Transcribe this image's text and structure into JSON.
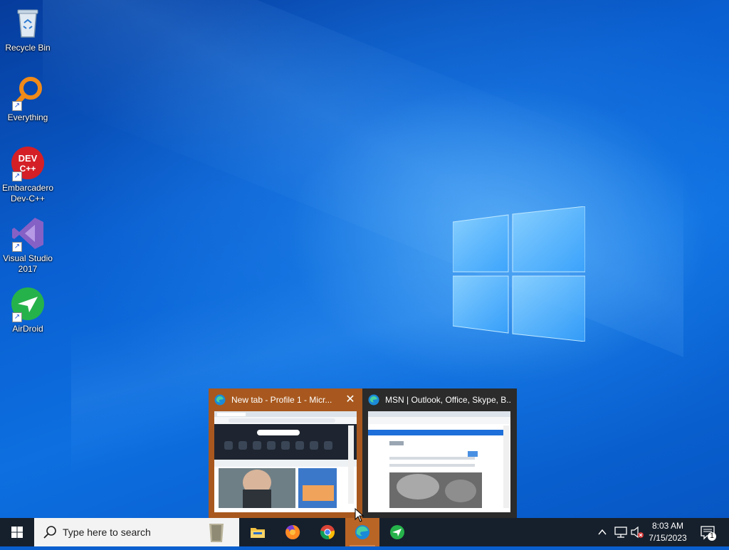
{
  "desktop": {
    "icons": [
      {
        "label": "Recycle Bin",
        "icon": "recycle-bin-icon"
      },
      {
        "label": "Everything",
        "icon": "everything-search-icon"
      },
      {
        "label": "Embarcadero Dev-C++",
        "icon": "devcpp-icon",
        "logo_text": "DEV C++"
      },
      {
        "label": "Visual Studio 2017",
        "icon": "visual-studio-icon"
      },
      {
        "label": "AirDroid",
        "icon": "airdroid-icon"
      }
    ]
  },
  "thumbnails": [
    {
      "title": "New tab - Profile 1 - Micr...",
      "close_label": "✕",
      "state": "hover"
    },
    {
      "title": "MSN | Outlook, Office, Skype, B...",
      "state": "normal"
    }
  ],
  "taskbar": {
    "search_placeholder": "Type here to search",
    "apps": [
      {
        "name": "File Explorer",
        "icon": "folder-icon"
      },
      {
        "name": "Firefox",
        "icon": "firefox-icon"
      },
      {
        "name": "Chrome",
        "icon": "chrome-icon"
      },
      {
        "name": "Microsoft Edge",
        "icon": "edge-icon",
        "active": true
      },
      {
        "name": "AirDroid",
        "icon": "airdroid-icon"
      }
    ],
    "tray": {
      "chevron": "^",
      "time": "8:03 AM",
      "date": "7/15/2023",
      "notification_count": "1"
    }
  },
  "colors": {
    "taskbar_bg": "#16202c",
    "active_app": "#b96526",
    "thumb_hover": "#a8581e",
    "thumb_normal": "#2b2b2b"
  }
}
